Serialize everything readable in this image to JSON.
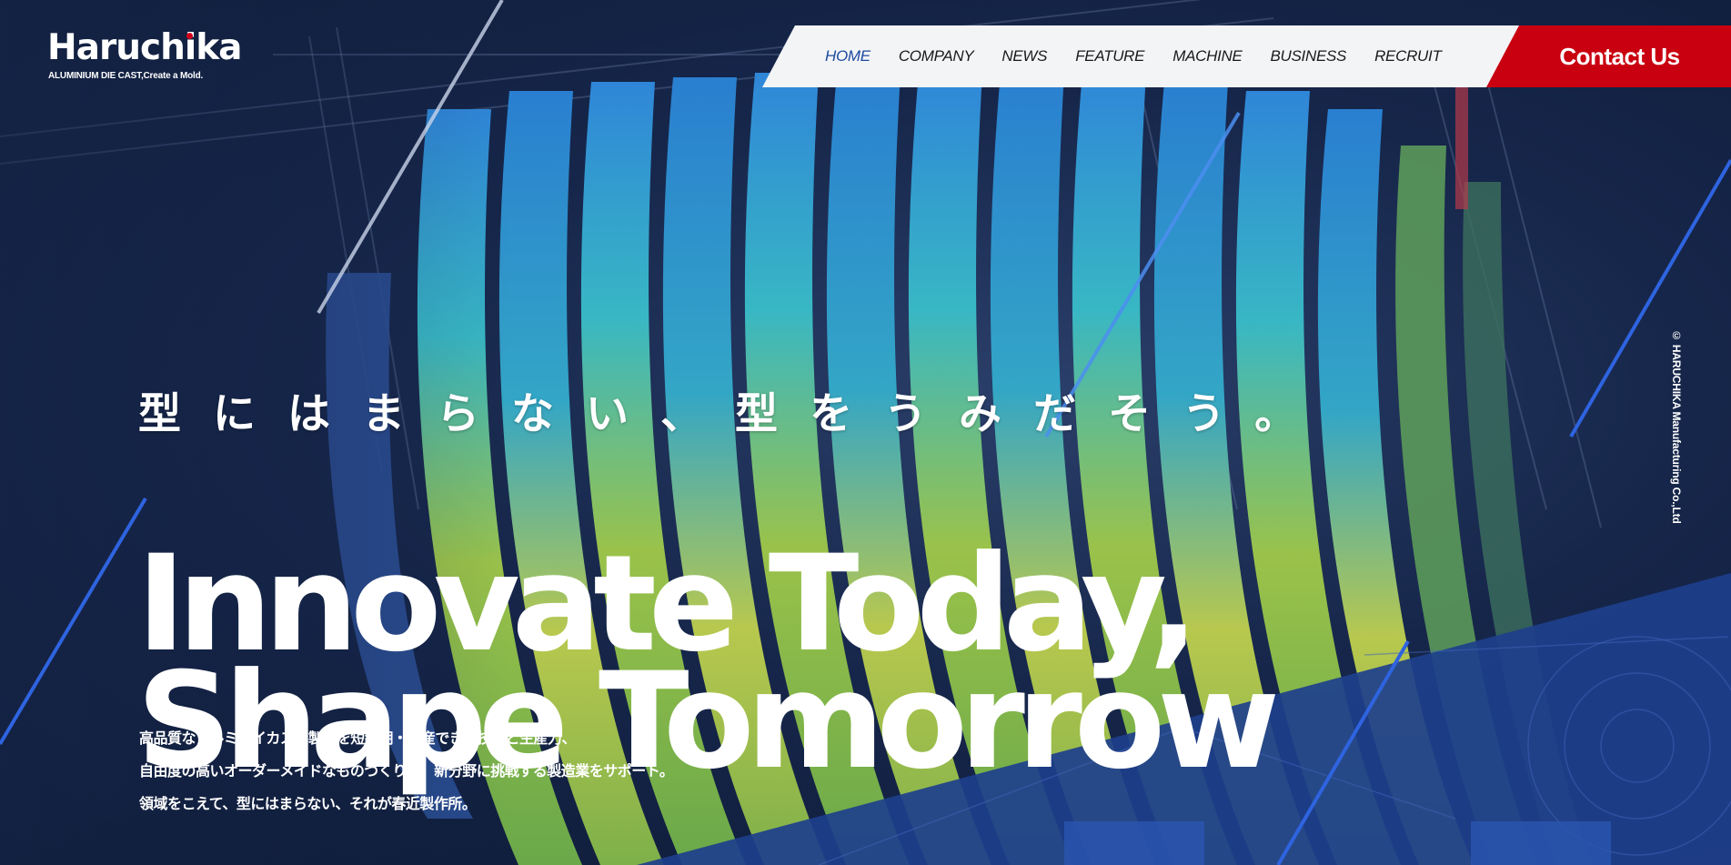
{
  "logo": {
    "name": "Haruchika",
    "tagline": "ALUMINIUM DIE CAST,Create a Mold."
  },
  "nav": {
    "items": [
      {
        "label": "HOME",
        "active": true
      },
      {
        "label": "COMPANY",
        "active": false
      },
      {
        "label": "NEWS",
        "active": false
      },
      {
        "label": "FEATURE",
        "active": false
      },
      {
        "label": "MACHINE",
        "active": false
      },
      {
        "label": "BUSINESS",
        "active": false
      },
      {
        "label": "RECRUIT",
        "active": false
      }
    ],
    "contact_label": "Contact Us"
  },
  "hero": {
    "catch_jp": "型にはまらない、型をうみだそう。",
    "headline_line1": "Innovate Today,",
    "headline_line2": "Shape Tomorrow",
    "lead_line1": "高品質なアルミダイカスト製品を短納期・量産できる技術と生産力、",
    "lead_line2": "自由度の高いオーダーメイドなものづくりで、新分野に挑戦する製造業をサポート。",
    "lead_line3": "領域をこえて、型にはまらない、それが春近製作所。"
  },
  "copyright": "© HARUCHIKA Manufacturing Co.,Ltd",
  "colors": {
    "brand_red": "#c90010",
    "nav_active": "#1e4aa0",
    "background": "#0f1c3d",
    "accent_blue": "#2f64e0"
  },
  "icons": [
    "logo-dot-icon"
  ]
}
